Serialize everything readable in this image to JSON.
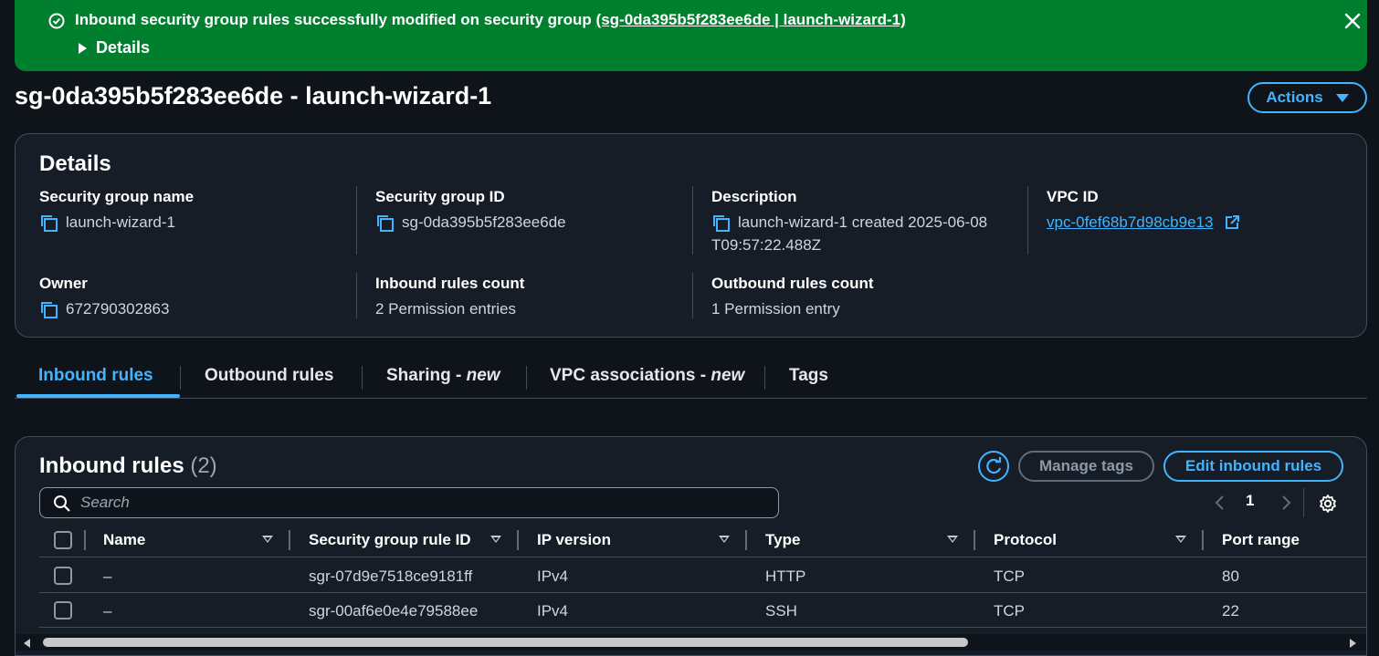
{
  "flash": {
    "message": "Inbound security group rules successfully modified on security group ",
    "link": "(sg-0da395b5f283ee6de | launch-wizard-1)",
    "details_label": "Details",
    "color": "#00802f"
  },
  "page": {
    "title": "sg-0da395b5f283ee6de - launch-wizard-1",
    "actions_label": "Actions"
  },
  "details": {
    "title": "Details",
    "security_group_name": {
      "label": "Security group name",
      "value": "launch-wizard-1"
    },
    "security_group_id": {
      "label": "Security group ID",
      "value": "sg-0da395b5f283ee6de"
    },
    "description": {
      "label": "Description",
      "value_line1": "launch-wizard-1 created 2025-06-08",
      "value_line2": "T09:57:22.488Z"
    },
    "vpc_id": {
      "label": "VPC ID",
      "value": "vpc-0fef68b7d98cb9e13"
    },
    "owner": {
      "label": "Owner",
      "value": "672790302863"
    },
    "inbound_count": {
      "label": "Inbound rules count",
      "value": "2 Permission entries"
    },
    "outbound_count": {
      "label": "Outbound rules count",
      "value": "1 Permission entry"
    }
  },
  "tabs": [
    {
      "label": "Inbound rules",
      "suffix": "",
      "active": true
    },
    {
      "label": "Outbound rules",
      "suffix": ""
    },
    {
      "label": "Sharing - ",
      "suffix": "new"
    },
    {
      "label": "VPC associations - ",
      "suffix": "new"
    },
    {
      "label": "Tags",
      "suffix": ""
    }
  ],
  "inbound_rules": {
    "title": "Inbound rules",
    "count": "(2)",
    "manage_tags_label": "Manage tags",
    "edit_label": "Edit inbound rules",
    "search_placeholder": "Search",
    "page_number": "1",
    "columns": [
      "Name",
      "Security group rule ID",
      "IP version",
      "Type",
      "Protocol",
      "Port range"
    ],
    "rows": [
      {
        "name": "–",
        "rule_id": "sgr-07d9e7518ce9181ff",
        "ip_version": "IPv4",
        "type": "HTTP",
        "protocol": "TCP",
        "port_range": "80"
      },
      {
        "name": "–",
        "rule_id": "sgr-00af6e0e4e79588ee",
        "ip_version": "IPv4",
        "type": "SSH",
        "protocol": "TCP",
        "port_range": "22"
      }
    ]
  },
  "colors": {
    "accent": "#42b4ff",
    "background": "#0f141a",
    "panel": "#161d26",
    "success": "#00802f"
  }
}
